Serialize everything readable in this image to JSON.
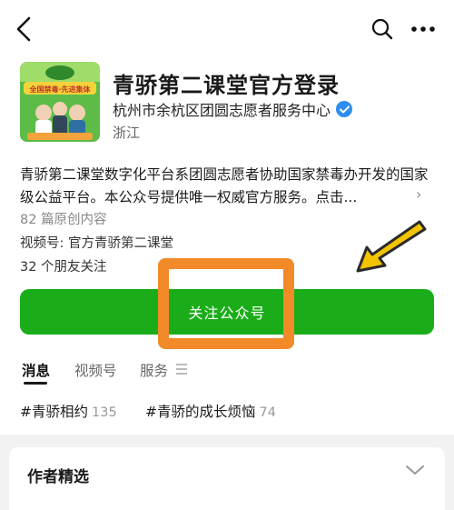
{
  "nav": {
    "back_icon": "chevron-left-icon",
    "search_icon": "search-icon",
    "more_icon": "more-horizontal-icon"
  },
  "profile": {
    "name": "青骄第二课堂官方登录",
    "organization": "杭州市余杭区团圆志愿者服务中心",
    "region": "浙江",
    "avatar_banner": "全国禁毒·先进集体"
  },
  "description": {
    "text": "青骄第二课堂数字化平台系团圆志愿者协助国家禁毒办开发的国家级公益平台。本公众号提供唯一权威官方服务。点击...",
    "more": "›"
  },
  "stats": {
    "original_count": "82 篇原创内容",
    "video_account": "视频号: 官方青骄第二课堂",
    "friends_following": "32 个朋友关注"
  },
  "follow_button": {
    "label": "关注公众号"
  },
  "tabs": [
    {
      "label": "消息"
    },
    {
      "label": "视频号"
    },
    {
      "label": "服务"
    }
  ],
  "hashtags": [
    {
      "label": "#青骄相约",
      "count": "135"
    },
    {
      "label": "#青骄的成长烦恼",
      "count": "74"
    }
  ],
  "author_pick": {
    "title": "作者精选"
  },
  "colors": {
    "accent": "#1aad19",
    "highlight_box": "#f28a2a",
    "arrow": "#f5c400",
    "verified": "#2f8df0"
  }
}
